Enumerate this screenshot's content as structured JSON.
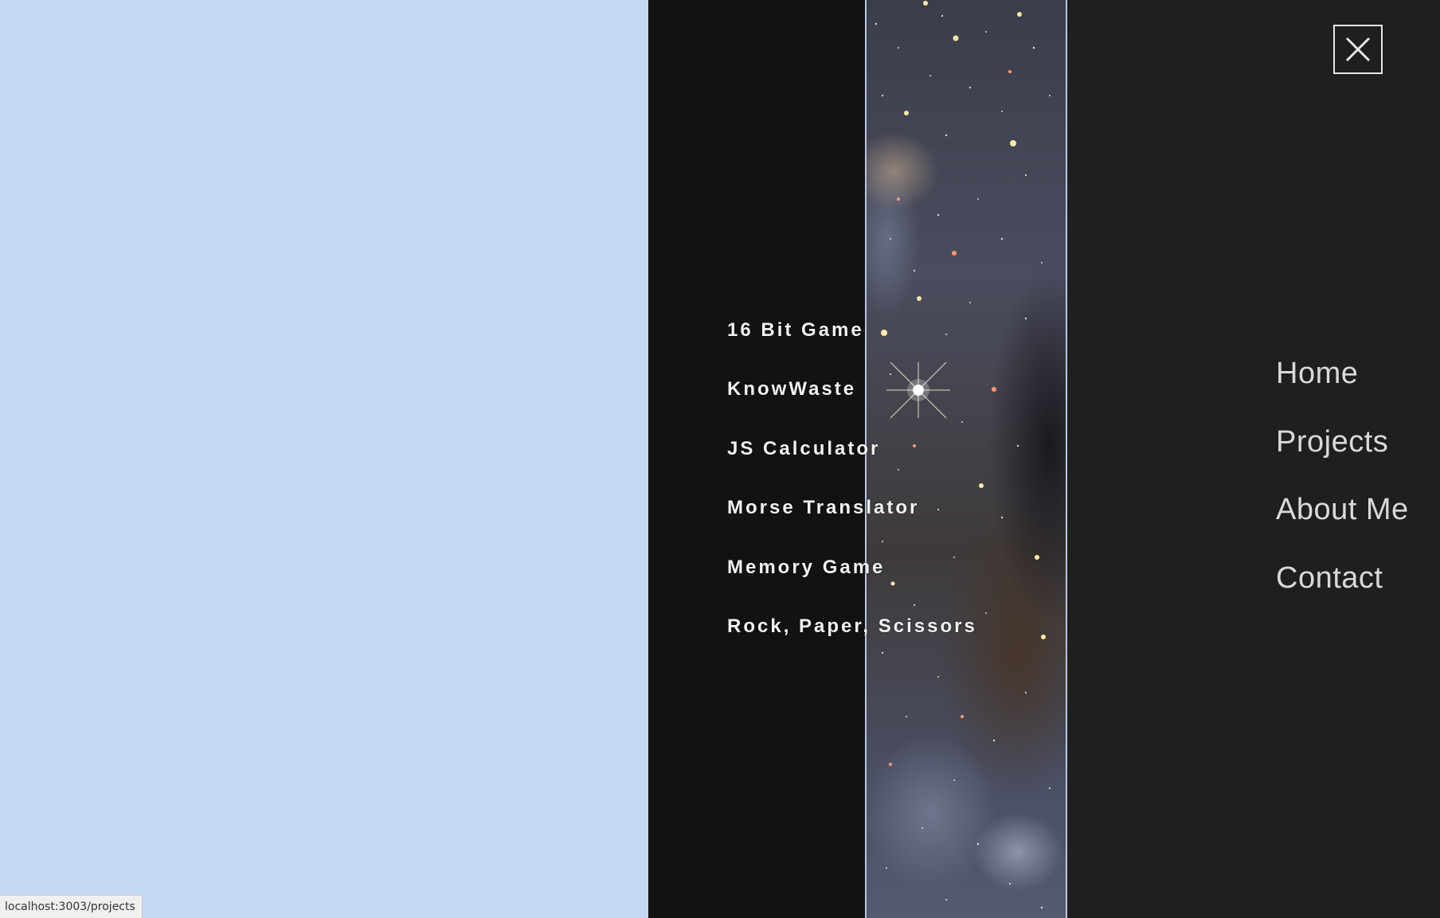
{
  "overlay_menu": {
    "close_button_label": "close",
    "projects": [
      {
        "label": "16 Bit Game"
      },
      {
        "label": "KnowWaste"
      },
      {
        "label": "JS Calculator"
      },
      {
        "label": "Morse Translator"
      },
      {
        "label": "Memory Game"
      },
      {
        "label": "Rock, Paper, Scissors"
      }
    ],
    "nav": [
      {
        "label": "Home"
      },
      {
        "label": "Projects"
      },
      {
        "label": "About Me"
      },
      {
        "label": "Contact"
      }
    ]
  },
  "status_bar": {
    "url": "localhost:3003/projects"
  },
  "colors": {
    "left_background": "#c4d8f2",
    "projects_panel": "#121212",
    "nav_panel": "#1f1f1f",
    "text": "#f2f2f2"
  },
  "icons": {
    "close": "close-icon"
  }
}
